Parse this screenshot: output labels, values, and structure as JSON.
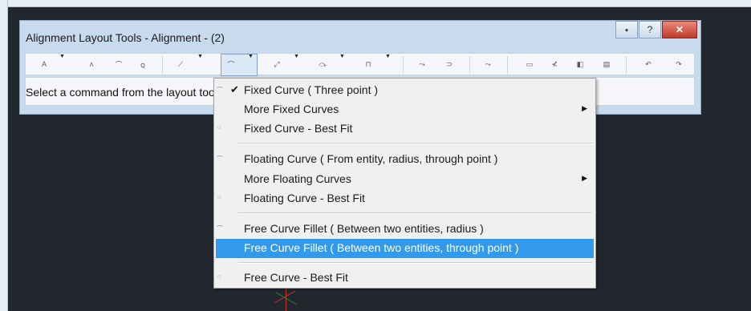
{
  "window": {
    "title": "Alignment Layout Tools - Alignment - (2)"
  },
  "titlebar_buttons": {
    "help": "?",
    "close": "✕",
    "pin": "⬩"
  },
  "toolbar": {
    "icons": [
      "A",
      "ʌ",
      "⌒",
      "ꞯ",
      "⟋",
      "⌒",
      "⤢",
      "⤼",
      "⊓",
      "⤳",
      "⊃",
      "⤳",
      "▭",
      "⊀",
      "◧",
      "▤",
      "↶",
      "↷"
    ]
  },
  "status": {
    "text": "Select a command from the layout tools toolbar"
  },
  "menu": {
    "items": [
      {
        "label": "Fixed Curve ( Three point )",
        "checked": true,
        "icon": "⌒"
      },
      {
        "label": "More Fixed Curves",
        "submenu": "▶"
      },
      {
        "label": "Fixed Curve - Best Fit",
        "icon": "⁘"
      },
      {
        "label": "Floating Curve ( From entity, radius, through point )",
        "icon": "⌒"
      },
      {
        "label": "More Floating Curves",
        "submenu": "▶"
      },
      {
        "label": "Floating Curve - Best Fit",
        "icon": "⁘"
      },
      {
        "label": "Free Curve Fillet ( Between two entities, radius )",
        "icon": "⌒"
      },
      {
        "label": "Free Curve Fillet ( Between two entities, through point )",
        "icon": "⌒",
        "selected": true
      },
      {
        "label": "Free Curve - Best Fit",
        "icon": "⁘"
      }
    ],
    "checkmark": "✔"
  },
  "colors": {
    "highlight": "#3399ea",
    "canvas": "#22272e",
    "dialog": "#c7daee"
  }
}
